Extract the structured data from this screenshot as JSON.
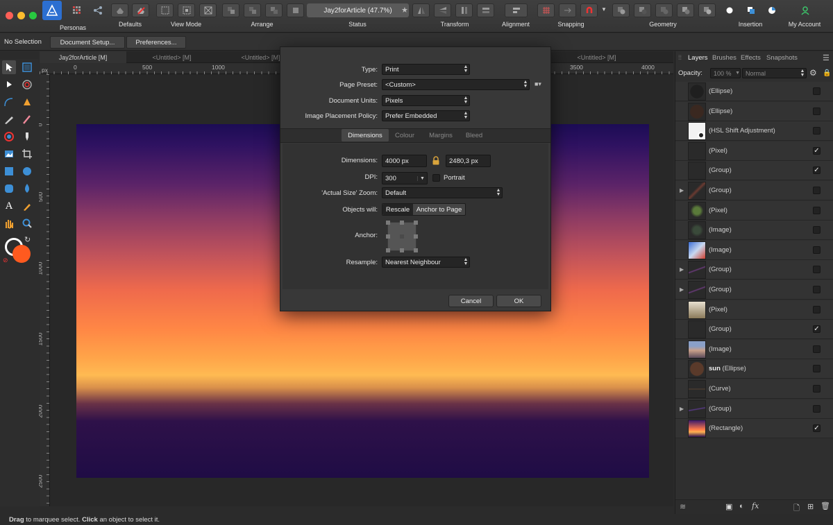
{
  "toolbar": {
    "personas_label": "Personas",
    "groups": {
      "defaults": "Defaults",
      "view_mode": "View Mode",
      "arrange": "Arrange",
      "status": "Status",
      "transform": "Transform",
      "alignment": "Alignment",
      "snapping": "Snapping",
      "geometry": "Geometry",
      "insertion": "Insertion",
      "my_account": "My Account"
    },
    "status_title": "Jay2forArticle (47.7%)"
  },
  "context": {
    "selection": "No Selection",
    "document_setup": "Document Setup...",
    "preferences": "Preferences..."
  },
  "doc_tabs": [
    "Jay2forArticle [M]",
    "<Untitled> [M]",
    "<Untitled> [M]",
    "<Untitled> [M]",
    "<Untitled> [M]"
  ],
  "rulers": {
    "unit": "px",
    "h_ticks": [
      "0",
      "500",
      "1000",
      "3500",
      "4000"
    ],
    "v_ticks": [
      "0",
      "500",
      "1000",
      "1500",
      "2000",
      "2500"
    ]
  },
  "dialog": {
    "type": {
      "label": "Type:",
      "value": "Print"
    },
    "page_preset": {
      "label": "Page Preset:",
      "value": "<Custom>"
    },
    "units": {
      "label": "Document Units:",
      "value": "Pixels"
    },
    "placement": {
      "label": "Image Placement Policy:",
      "value": "Prefer Embedded"
    },
    "tabs": [
      "Dimensions",
      "Colour",
      "Margins",
      "Bleed"
    ],
    "dimensions": {
      "label": "Dimensions:",
      "width": "4000 px",
      "height": "2480,3 px"
    },
    "dpi": {
      "label": "DPI:",
      "value": "300"
    },
    "portrait_label": "Portrait",
    "zoom": {
      "label": "'Actual Size' Zoom:",
      "value": "Default"
    },
    "objects": {
      "label": "Objects will:",
      "rescale": "Rescale",
      "anchor_to_page": "Anchor to Page"
    },
    "anchor_label": "Anchor:",
    "resample": {
      "label": "Resample:",
      "value": "Nearest Neighbour"
    },
    "cancel": "Cancel",
    "ok": "OK"
  },
  "panel": {
    "tabs": [
      "Layers",
      "Brushes",
      "Effects",
      "Snapshots"
    ],
    "opacity_label": "Opacity:",
    "opacity_value": "100 %",
    "blend_mode": "Normal",
    "layers": [
      {
        "bold": "",
        "name": "(Ellipse)",
        "checked": false,
        "expand": false,
        "thumb": "ellipse-dark"
      },
      {
        "bold": "",
        "name": "(Ellipse)",
        "checked": false,
        "expand": false,
        "thumb": "ellipse-brown"
      },
      {
        "bold": "",
        "name": "(HSL Shift Adjustment)",
        "checked": false,
        "expand": false,
        "thumb": "hsl"
      },
      {
        "bold": "",
        "name": "(Pixel)",
        "checked": true,
        "expand": false,
        "thumb": "empty"
      },
      {
        "bold": "",
        "name": "(Group)",
        "checked": true,
        "expand": false,
        "thumb": "empty"
      },
      {
        "bold": "",
        "name": "(Group)",
        "checked": false,
        "expand": true,
        "thumb": "bird-dark"
      },
      {
        "bold": "",
        "name": "(Pixel)",
        "checked": false,
        "expand": false,
        "thumb": "bird-green"
      },
      {
        "bold": "",
        "name": "(Image)",
        "checked": false,
        "expand": false,
        "thumb": "bird-dark2"
      },
      {
        "bold": "",
        "name": "(Image)",
        "checked": false,
        "expand": false,
        "thumb": "bird-blue"
      },
      {
        "bold": "",
        "name": "(Group)",
        "checked": false,
        "expand": true,
        "thumb": "stroke"
      },
      {
        "bold": "",
        "name": "(Group)",
        "checked": false,
        "expand": true,
        "thumb": "stroke"
      },
      {
        "bold": "",
        "name": "(Pixel)",
        "checked": false,
        "expand": false,
        "thumb": "bottle"
      },
      {
        "bold": "",
        "name": "(Group)",
        "checked": true,
        "expand": false,
        "thumb": "empty"
      },
      {
        "bold": "",
        "name": "(Image)",
        "checked": false,
        "expand": false,
        "thumb": "mountain"
      },
      {
        "bold": "sun",
        "name": " (Ellipse)",
        "checked": false,
        "expand": false,
        "thumb": "sun"
      },
      {
        "bold": "",
        "name": "(Curve)",
        "checked": false,
        "expand": false,
        "thumb": "curve"
      },
      {
        "bold": "",
        "name": "(Group)",
        "checked": false,
        "expand": true,
        "thumb": "stroke2"
      },
      {
        "bold": "",
        "name": "(Rectangle)",
        "checked": true,
        "expand": false,
        "thumb": "sunset"
      }
    ]
  },
  "statusbar": {
    "drag": "Drag",
    "t1": " to marquee select. ",
    "click": "Click",
    "t2": " an object to select it."
  },
  "colors": {
    "accent_blue": "#3d8fd6",
    "primary_swatch": "#ff5a1f",
    "green_account": "#3cc46a"
  }
}
